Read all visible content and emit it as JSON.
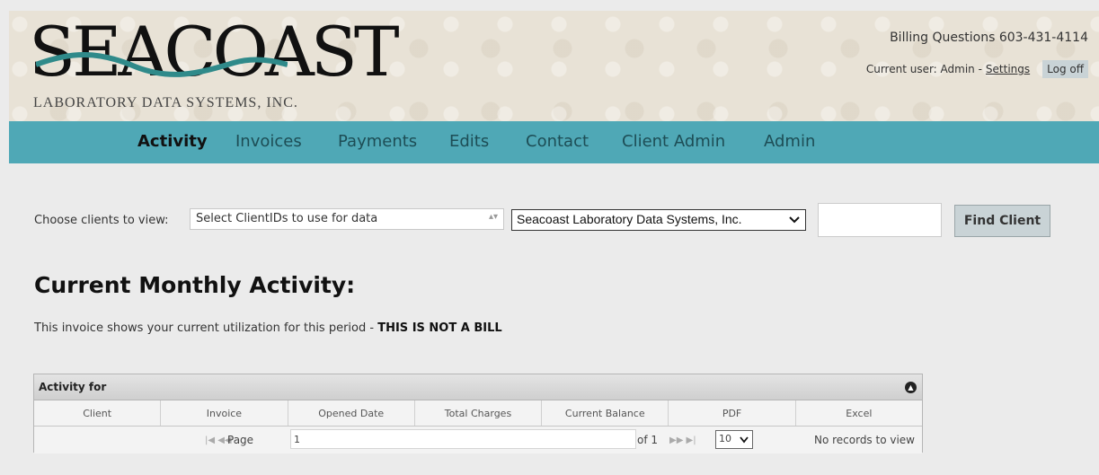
{
  "header": {
    "logo_text": "SEACOAST",
    "logo_subtitle": "LABORATORY DATA SYSTEMS, INC.",
    "billing_questions": "Billing Questions 603-431-4114",
    "current_user_text": "Current user: Admin -",
    "settings_link": "Settings",
    "logoff_label": "Log off"
  },
  "nav": {
    "items": [
      {
        "label": "Activity",
        "active": true
      },
      {
        "label": "Invoices",
        "active": false
      },
      {
        "label": "Payments",
        "active": false
      },
      {
        "label": "Edits",
        "active": false
      },
      {
        "label": "Contact",
        "active": false
      },
      {
        "label": "Client Admin",
        "active": false
      },
      {
        "label": "Admin",
        "active": false
      }
    ]
  },
  "filters": {
    "choose_label": "Choose clients to view:",
    "client_select_value": "Select ClientIDs to use for data",
    "org_select_value": "Seacoast Laboratory Data Systems, Inc.",
    "client_input_value": "",
    "find_button": "Find Client"
  },
  "main": {
    "title": "Current Monthly Activity:",
    "note_prefix": "This invoice shows your current utilization for this period - ",
    "note_bold": "THIS IS NOT A BILL"
  },
  "grid": {
    "caption": "Activity for",
    "columns": [
      "Client",
      "Invoice",
      "Opened Date",
      "Total Charges",
      "Current Balance",
      "PDF",
      "Excel"
    ],
    "pager": {
      "page_label": "Page",
      "page_value": "1",
      "of_label": "of 1",
      "page_size": "10",
      "records_text": "No records to view"
    }
  },
  "colors": {
    "nav_bg": "#4fa8b6",
    "page_bg": "#ebebeb",
    "button_bg": "#c9d3d6"
  }
}
